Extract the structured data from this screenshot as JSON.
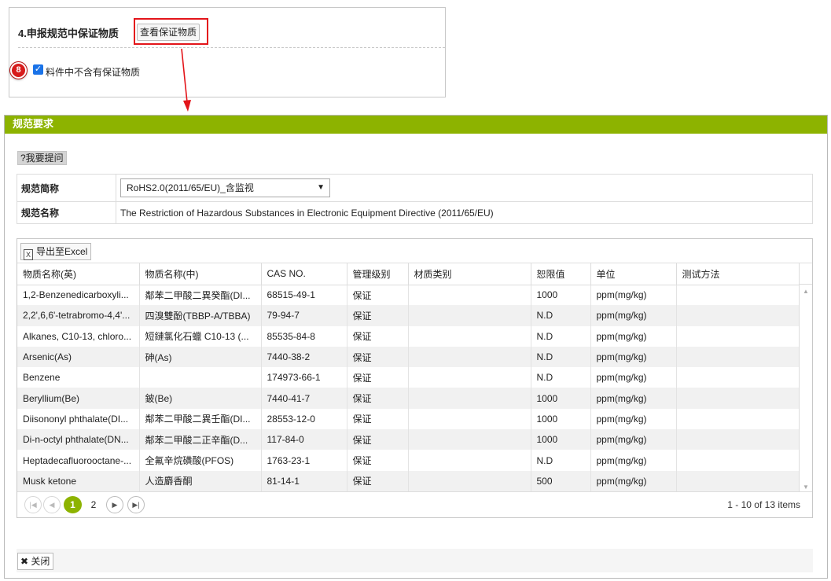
{
  "top": {
    "section_title": "4.申报规范中保证物质",
    "view_button": "查看保证物质",
    "badge": "8",
    "checkbox_label": "料件中不含有保证物质",
    "checkbox_checked": true
  },
  "dialog": {
    "title": "规范要求",
    "ask_button": "?我要提问",
    "info": {
      "abbr_label": "规范简称",
      "abbr_value": "RoHS2.0(2011/65/EU)_含监视",
      "name_label": "规范名称",
      "name_value": "The Restriction of Hazardous Substances in Electronic Equipment Directive (2011/65/EU)"
    },
    "export_button": "导出至Excel",
    "excel_icon": "excel-icon",
    "columns": [
      "物质名称(英)",
      "物质名称(中)",
      "CAS NO.",
      "管理级别",
      "材质类别",
      "恕限值",
      "单位",
      "测试方法"
    ],
    "rows": [
      [
        "1,2-Benzenedicarboxyli...",
        "鄰苯二甲酸二異癸酯(DI...",
        "68515-49-1",
        "保证",
        "",
        "1000",
        "ppm(mg/kg)",
        ""
      ],
      [
        "2,2',6,6'-tetrabromo-4,4'...",
        "四溴雙酚(TBBP-A/TBBA)",
        "79-94-7",
        "保证",
        "",
        "N.D",
        "ppm(mg/kg)",
        ""
      ],
      [
        "Alkanes, C10-13, chloro...",
        "短鏈氯化石蠟 C10-13 (...",
        "85535-84-8",
        "保证",
        "",
        "N.D",
        "ppm(mg/kg)",
        ""
      ],
      [
        "Arsenic(As)",
        "砷(As)",
        "7440-38-2",
        "保证",
        "",
        "N.D",
        "ppm(mg/kg)",
        ""
      ],
      [
        "Benzene",
        "",
        "174973-66-1",
        "保证",
        "",
        "N.D",
        "ppm(mg/kg)",
        ""
      ],
      [
        "Beryllium(Be)",
        "鈹(Be)",
        "7440-41-7",
        "保证",
        "",
        "1000",
        "ppm(mg/kg)",
        ""
      ],
      [
        "Diisononyl phthalate(DI...",
        "鄰苯二甲酸二異壬酯(DI...",
        "28553-12-0",
        "保证",
        "",
        "1000",
        "ppm(mg/kg)",
        ""
      ],
      [
        "Di-n-octyl phthalate(DN...",
        "鄰苯二甲酸二正辛酯(D...",
        "117-84-0",
        "保证",
        "",
        "1000",
        "ppm(mg/kg)",
        ""
      ],
      [
        "Heptadecafluorooctane-...",
        "全氟辛烷磺酸(PFOS)",
        "1763-23-1",
        "保证",
        "",
        "N.D",
        "ppm(mg/kg)",
        ""
      ],
      [
        "Musk ketone",
        "人造麝香酮",
        "81-14-1",
        "保证",
        "",
        "500",
        "ppm(mg/kg)",
        ""
      ]
    ],
    "pager": {
      "pages": [
        "1",
        "2"
      ],
      "current": "1",
      "info": "1 - 10 of 13 items"
    },
    "close_button": "关闭",
    "colors": {
      "header": "#8db300",
      "highlight": "#e3151a",
      "badge": "#d71c1c"
    }
  }
}
